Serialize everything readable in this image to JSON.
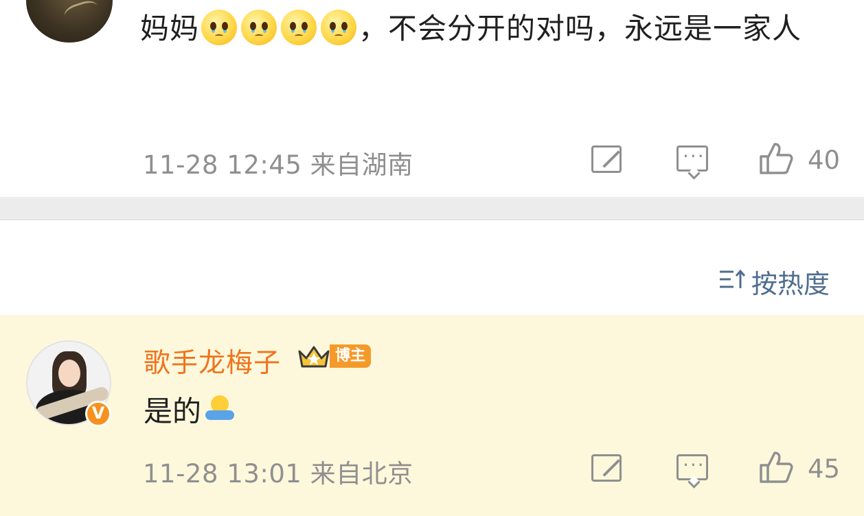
{
  "comment1": {
    "text_start": "妈妈",
    "emoji_name": "cry-emoji",
    "text_end": "，不会分开的对吗，永远是一家人",
    "timestamp": "11-28 12:45",
    "location": "来自湖南",
    "likes": "40"
  },
  "sort": {
    "label": "按热度"
  },
  "comment2": {
    "username": "歌手龙梅子",
    "badge": "博主",
    "verified_mark": "V",
    "text": "是的",
    "emoji_name": "hug-emoji",
    "timestamp": "11-28 13:01",
    "location": "来自北京",
    "likes": "45"
  },
  "colors": {
    "username": "#f0731c",
    "meta_gray": "#8f8f8f",
    "sort_blue": "#506d90",
    "highlight_bg": "#fdf8dc",
    "divider": "#ececec"
  }
}
